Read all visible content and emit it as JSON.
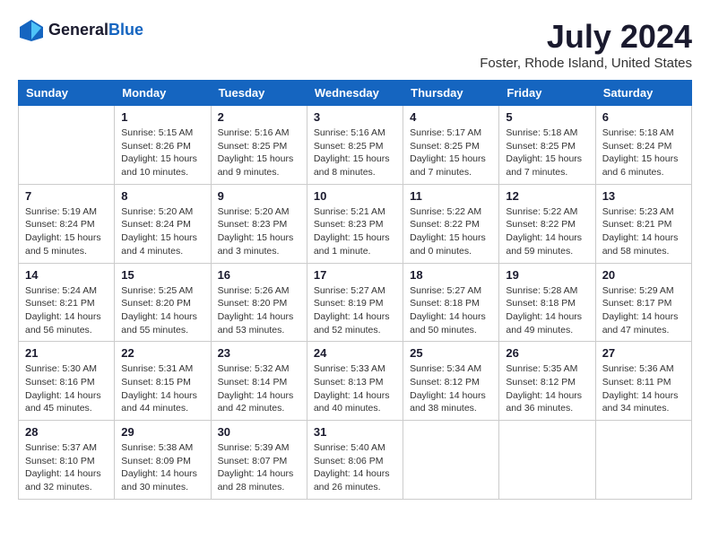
{
  "logo": {
    "text_general": "General",
    "text_blue": "Blue"
  },
  "title": "July 2024",
  "subtitle": "Foster, Rhode Island, United States",
  "days_header": [
    "Sunday",
    "Monday",
    "Tuesday",
    "Wednesday",
    "Thursday",
    "Friday",
    "Saturday"
  ],
  "weeks": [
    [
      {
        "day": "",
        "info": ""
      },
      {
        "day": "1",
        "info": "Sunrise: 5:15 AM\nSunset: 8:26 PM\nDaylight: 15 hours\nand 10 minutes."
      },
      {
        "day": "2",
        "info": "Sunrise: 5:16 AM\nSunset: 8:25 PM\nDaylight: 15 hours\nand 9 minutes."
      },
      {
        "day": "3",
        "info": "Sunrise: 5:16 AM\nSunset: 8:25 PM\nDaylight: 15 hours\nand 8 minutes."
      },
      {
        "day": "4",
        "info": "Sunrise: 5:17 AM\nSunset: 8:25 PM\nDaylight: 15 hours\nand 7 minutes."
      },
      {
        "day": "5",
        "info": "Sunrise: 5:18 AM\nSunset: 8:25 PM\nDaylight: 15 hours\nand 7 minutes."
      },
      {
        "day": "6",
        "info": "Sunrise: 5:18 AM\nSunset: 8:24 PM\nDaylight: 15 hours\nand 6 minutes."
      }
    ],
    [
      {
        "day": "7",
        "info": "Sunrise: 5:19 AM\nSunset: 8:24 PM\nDaylight: 15 hours\nand 5 minutes."
      },
      {
        "day": "8",
        "info": "Sunrise: 5:20 AM\nSunset: 8:24 PM\nDaylight: 15 hours\nand 4 minutes."
      },
      {
        "day": "9",
        "info": "Sunrise: 5:20 AM\nSunset: 8:23 PM\nDaylight: 15 hours\nand 3 minutes."
      },
      {
        "day": "10",
        "info": "Sunrise: 5:21 AM\nSunset: 8:23 PM\nDaylight: 15 hours\nand 1 minute."
      },
      {
        "day": "11",
        "info": "Sunrise: 5:22 AM\nSunset: 8:22 PM\nDaylight: 15 hours\nand 0 minutes."
      },
      {
        "day": "12",
        "info": "Sunrise: 5:22 AM\nSunset: 8:22 PM\nDaylight: 14 hours\nand 59 minutes."
      },
      {
        "day": "13",
        "info": "Sunrise: 5:23 AM\nSunset: 8:21 PM\nDaylight: 14 hours\nand 58 minutes."
      }
    ],
    [
      {
        "day": "14",
        "info": "Sunrise: 5:24 AM\nSunset: 8:21 PM\nDaylight: 14 hours\nand 56 minutes."
      },
      {
        "day": "15",
        "info": "Sunrise: 5:25 AM\nSunset: 8:20 PM\nDaylight: 14 hours\nand 55 minutes."
      },
      {
        "day": "16",
        "info": "Sunrise: 5:26 AM\nSunset: 8:20 PM\nDaylight: 14 hours\nand 53 minutes."
      },
      {
        "day": "17",
        "info": "Sunrise: 5:27 AM\nSunset: 8:19 PM\nDaylight: 14 hours\nand 52 minutes."
      },
      {
        "day": "18",
        "info": "Sunrise: 5:27 AM\nSunset: 8:18 PM\nDaylight: 14 hours\nand 50 minutes."
      },
      {
        "day": "19",
        "info": "Sunrise: 5:28 AM\nSunset: 8:18 PM\nDaylight: 14 hours\nand 49 minutes."
      },
      {
        "day": "20",
        "info": "Sunrise: 5:29 AM\nSunset: 8:17 PM\nDaylight: 14 hours\nand 47 minutes."
      }
    ],
    [
      {
        "day": "21",
        "info": "Sunrise: 5:30 AM\nSunset: 8:16 PM\nDaylight: 14 hours\nand 45 minutes."
      },
      {
        "day": "22",
        "info": "Sunrise: 5:31 AM\nSunset: 8:15 PM\nDaylight: 14 hours\nand 44 minutes."
      },
      {
        "day": "23",
        "info": "Sunrise: 5:32 AM\nSunset: 8:14 PM\nDaylight: 14 hours\nand 42 minutes."
      },
      {
        "day": "24",
        "info": "Sunrise: 5:33 AM\nSunset: 8:13 PM\nDaylight: 14 hours\nand 40 minutes."
      },
      {
        "day": "25",
        "info": "Sunrise: 5:34 AM\nSunset: 8:12 PM\nDaylight: 14 hours\nand 38 minutes."
      },
      {
        "day": "26",
        "info": "Sunrise: 5:35 AM\nSunset: 8:12 PM\nDaylight: 14 hours\nand 36 minutes."
      },
      {
        "day": "27",
        "info": "Sunrise: 5:36 AM\nSunset: 8:11 PM\nDaylight: 14 hours\nand 34 minutes."
      }
    ],
    [
      {
        "day": "28",
        "info": "Sunrise: 5:37 AM\nSunset: 8:10 PM\nDaylight: 14 hours\nand 32 minutes."
      },
      {
        "day": "29",
        "info": "Sunrise: 5:38 AM\nSunset: 8:09 PM\nDaylight: 14 hours\nand 30 minutes."
      },
      {
        "day": "30",
        "info": "Sunrise: 5:39 AM\nSunset: 8:07 PM\nDaylight: 14 hours\nand 28 minutes."
      },
      {
        "day": "31",
        "info": "Sunrise: 5:40 AM\nSunset: 8:06 PM\nDaylight: 14 hours\nand 26 minutes."
      },
      {
        "day": "",
        "info": ""
      },
      {
        "day": "",
        "info": ""
      },
      {
        "day": "",
        "info": ""
      }
    ]
  ]
}
